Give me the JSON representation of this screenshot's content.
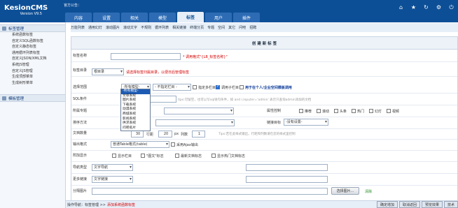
{
  "brand": {
    "name": "KesionCMS",
    "version": "Version V9.5"
  },
  "notice": "官方公告：",
  "tabs": [
    "内容",
    "设置",
    "相关",
    "模型",
    "标签",
    "用户",
    "插件"
  ],
  "active_tab": 4,
  "toolbar": {
    "icons": [
      "home-icon",
      "star-icon",
      "refresh-icon",
      "gear-icon",
      "power-icon"
    ],
    "glyphs": [
      "⌂",
      "★",
      "↻",
      "⚙",
      "⏻"
    ]
  },
  "sidebar": {
    "sec1": "标签管理",
    "items": [
      "系统函数标签",
      "自定义SQL函数标签",
      "自定义静态标签",
      "通用循环列表标签",
      "自定义JSON/XML文档",
      "系统JS管理",
      "自定义JS管理",
      "生成顶部菜单",
      "生成树形菜单"
    ],
    "sec2": "模板管理"
  },
  "subnav": [
    "万能列表",
    "通用幻灯",
    "滚动图片",
    "滚动文字",
    "不规则",
    "循环列表",
    "相关链接",
    "终端分页",
    "专题",
    "空间",
    "其它",
    "问吧",
    "招聘"
  ],
  "form": {
    "title": "创 建 新 标 签",
    "name_label": "标签名称",
    "name_hint": "* 调用格式\"{LB_标签名称}\"",
    "dir_label": "标签目录",
    "dir_value": "根目录",
    "dir_hint": "请选择标签归属目录，以便日后管理标签",
    "scope_label": "选择范围",
    "model_value": "-所有模型-",
    "column_value": "- 不指定栏目 -",
    "multi_label": "指定多栏目",
    "sub_label": "调用子栏目",
    "site_label": "用于在个人/企业空间模板调用",
    "sql_label": "SQL条件",
    "sql_tip": "tips:可留空，也可以写sql语句条件，如 and i.inputer='admin' 表示只查询admin添加的文档",
    "special_label": "所属专题",
    "attr_label": "属性控制",
    "attrs": [
      "推荐",
      "滚动",
      "头条",
      "热门",
      "幻灯",
      "视频"
    ],
    "sort_label": "排序方法",
    "target_label": "链接目标",
    "target_value": "-没有设置-",
    "count_label": "文档数量",
    "count_value": "30",
    "row_label": "行距",
    "row_value": "20",
    "px": "px",
    "col_label": "列数",
    "col_value": "1",
    "count_tip": "Tips:若在此样式输出，行距和列数请在您的样式里控制",
    "output_label": "输出格式",
    "output_value": "普通Table格式(table)",
    "ajax_label": "采用Ajax输出",
    "show_label": "附加显示",
    "show_items": [
      "显示栏目",
      "\"图文\"标志",
      "最新文档标志",
      "显示热门文档标志"
    ],
    "nav_label": "导航类型",
    "nav_value": "文字导航",
    "more_label": "更多链接",
    "more_value": "文字链接",
    "img_label": "分隔图片",
    "pick_btn": "选择图片...",
    "clear_label": "清除"
  },
  "dropdown": [
    "-所有模型-",
    "文章系统",
    "图片系统",
    "下载系统",
    "动漫系统",
    "商城系统",
    "影视系统",
    "供求系统",
    "问吧名片"
  ],
  "status": {
    "label": "操作导航：标签管理 >>",
    "current": "添加系统函数标签"
  },
  "bottom_buttons": [
    "确定增加",
    "取消返回",
    "预览效果",
    "技术"
  ]
}
